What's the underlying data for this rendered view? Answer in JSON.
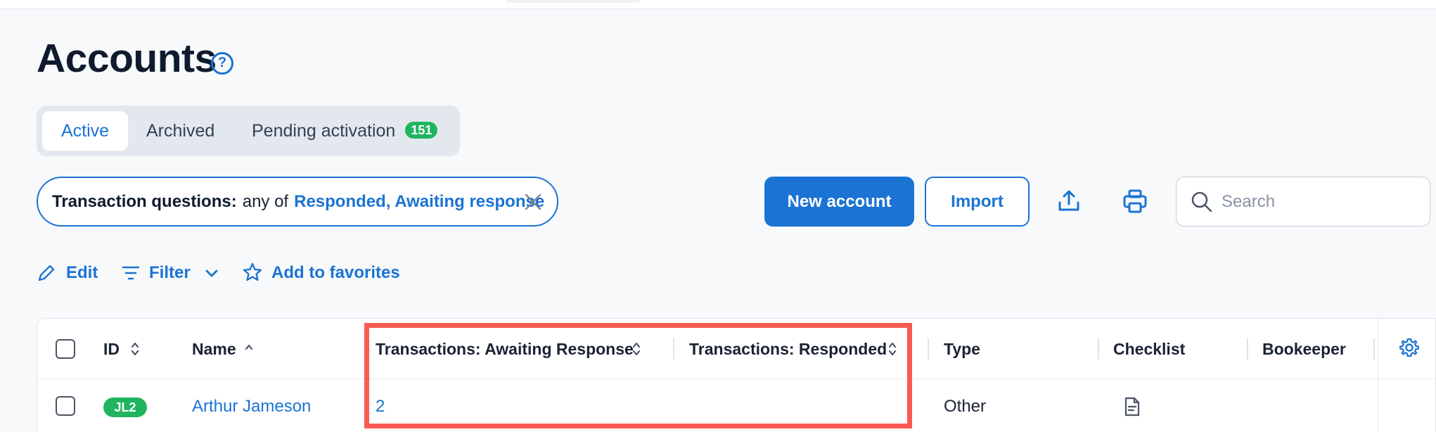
{
  "page": {
    "title": "Accounts"
  },
  "tabs": [
    {
      "label": "Active",
      "active": true
    },
    {
      "label": "Archived",
      "active": false
    },
    {
      "label": "Pending activation",
      "count": "151",
      "active": false
    }
  ],
  "filter_chip": {
    "key": "Transaction questions:",
    "operator": "any of",
    "value": "Responded, Awaiting response"
  },
  "toolbar": {
    "new_account": "New account",
    "import": "Import",
    "search_placeholder": "Search"
  },
  "actions": {
    "edit": "Edit",
    "filter": "Filter",
    "favorites": "Add to favorites"
  },
  "table": {
    "columns": {
      "id": "ID",
      "name": "Name",
      "awaiting": "Transactions: Awaiting Response",
      "responded": "Transactions: Responded",
      "type": "Type",
      "checklist": "Checklist",
      "bookkeeper": "Bookeeper"
    },
    "rows": [
      {
        "id": "JL2",
        "name": "Arthur Jameson",
        "awaiting": "2",
        "responded": "",
        "type": "Other"
      }
    ]
  },
  "colors": {
    "accent": "#1b73d3",
    "success": "#1fb55f",
    "highlight": "#fa5a52"
  },
  "icons": [
    "help-icon",
    "close-icon",
    "export-icon",
    "print-icon",
    "search-icon",
    "edit-icon",
    "filter-icon",
    "chevron-down-icon",
    "star-icon",
    "sort-icon",
    "document-icon",
    "gear-icon"
  ]
}
